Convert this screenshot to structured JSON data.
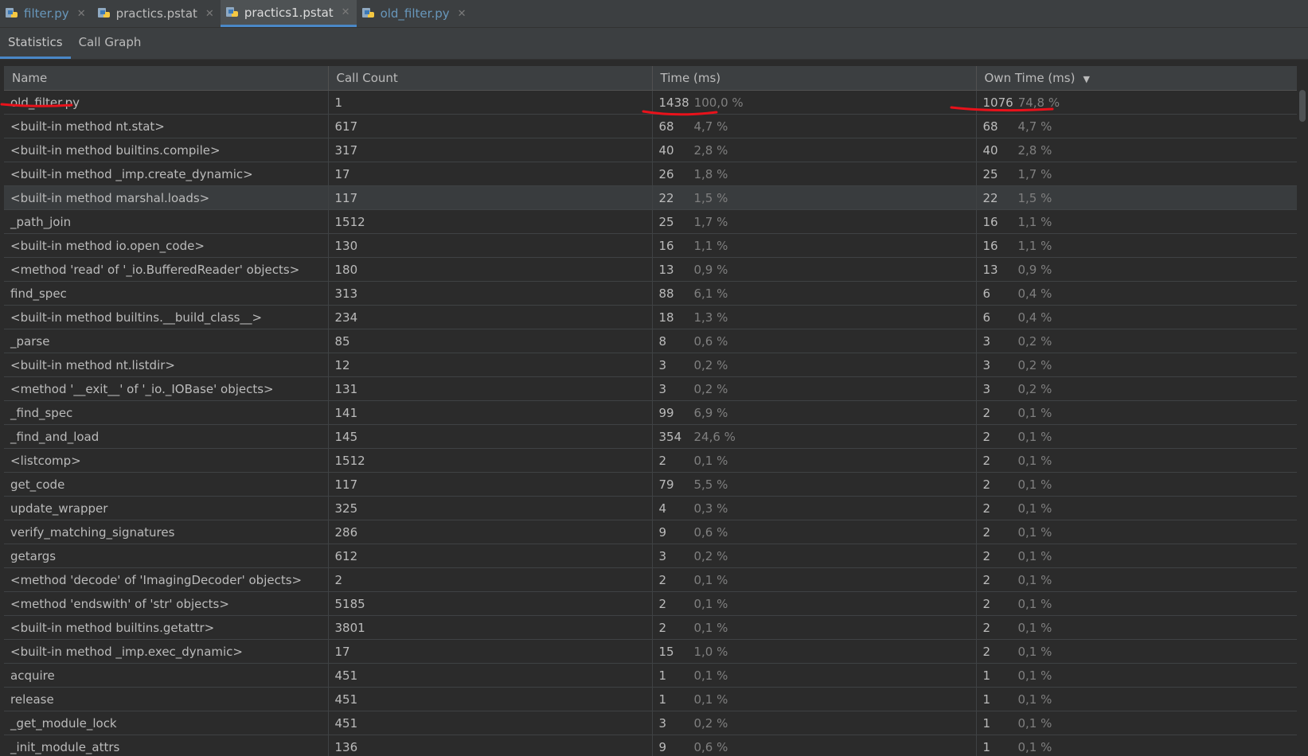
{
  "tabs": [
    {
      "label": "filter.py",
      "style": "blue"
    },
    {
      "label": "practics.pstat",
      "style": "plain"
    },
    {
      "label": "practics1.pstat",
      "style": "active"
    },
    {
      "label": "old_filter.py",
      "style": "blue"
    }
  ],
  "view_tabs": [
    {
      "label": "Statistics",
      "active": true
    },
    {
      "label": "Call Graph",
      "active": false
    }
  ],
  "columns": [
    "Name",
    "Call Count",
    "Time (ms)",
    "Own Time (ms)"
  ],
  "sort_column": "Own Time (ms)",
  "sort_direction": "descending",
  "rows": [
    {
      "name": "old_filter.py",
      "calls": "1",
      "time": "1438",
      "time_pct": "100,0 %",
      "own": "1076",
      "own_pct": "74,8 %"
    },
    {
      "name": "<built-in method nt.stat>",
      "calls": "617",
      "time": "68",
      "time_pct": "4,7 %",
      "own": "68",
      "own_pct": "4,7 %"
    },
    {
      "name": "<built-in method builtins.compile>",
      "calls": "317",
      "time": "40",
      "time_pct": "2,8 %",
      "own": "40",
      "own_pct": "2,8 %"
    },
    {
      "name": "<built-in method _imp.create_dynamic>",
      "calls": "17",
      "time": "26",
      "time_pct": "1,8 %",
      "own": "25",
      "own_pct": "1,7 %"
    },
    {
      "name": "<built-in method marshal.loads>",
      "calls": "117",
      "time": "22",
      "time_pct": "1,5 %",
      "own": "22",
      "own_pct": "1,5 %"
    },
    {
      "name": "_path_join",
      "calls": "1512",
      "time": "25",
      "time_pct": "1,7 %",
      "own": "16",
      "own_pct": "1,1 %"
    },
    {
      "name": "<built-in method io.open_code>",
      "calls": "130",
      "time": "16",
      "time_pct": "1,1 %",
      "own": "16",
      "own_pct": "1,1 %"
    },
    {
      "name": "<method 'read' of '_io.BufferedReader' objects>",
      "calls": "180",
      "time": "13",
      "time_pct": "0,9 %",
      "own": "13",
      "own_pct": "0,9 %"
    },
    {
      "name": "find_spec",
      "calls": "313",
      "time": "88",
      "time_pct": "6,1 %",
      "own": "6",
      "own_pct": "0,4 %"
    },
    {
      "name": "<built-in method builtins.__build_class__>",
      "calls": "234",
      "time": "18",
      "time_pct": "1,3 %",
      "own": "6",
      "own_pct": "0,4 %"
    },
    {
      "name": "_parse",
      "calls": "85",
      "time": "8",
      "time_pct": "0,6 %",
      "own": "3",
      "own_pct": "0,2 %"
    },
    {
      "name": "<built-in method nt.listdir>",
      "calls": "12",
      "time": "3",
      "time_pct": "0,2 %",
      "own": "3",
      "own_pct": "0,2 %"
    },
    {
      "name": "<method '__exit__' of '_io._IOBase' objects>",
      "calls": "131",
      "time": "3",
      "time_pct": "0,2 %",
      "own": "3",
      "own_pct": "0,2 %"
    },
    {
      "name": "_find_spec",
      "calls": "141",
      "time": "99",
      "time_pct": "6,9 %",
      "own": "2",
      "own_pct": "0,1 %"
    },
    {
      "name": "_find_and_load",
      "calls": "145",
      "time": "354",
      "time_pct": "24,6 %",
      "own": "2",
      "own_pct": "0,1 %"
    },
    {
      "name": "<listcomp>",
      "calls": "1512",
      "time": "2",
      "time_pct": "0,1 %",
      "own": "2",
      "own_pct": "0,1 %"
    },
    {
      "name": "get_code",
      "calls": "117",
      "time": "79",
      "time_pct": "5,5 %",
      "own": "2",
      "own_pct": "0,1 %"
    },
    {
      "name": "update_wrapper",
      "calls": "325",
      "time": "4",
      "time_pct": "0,3 %",
      "own": "2",
      "own_pct": "0,1 %"
    },
    {
      "name": "verify_matching_signatures",
      "calls": "286",
      "time": "9",
      "time_pct": "0,6 %",
      "own": "2",
      "own_pct": "0,1 %"
    },
    {
      "name": "getargs",
      "calls": "612",
      "time": "3",
      "time_pct": "0,2 %",
      "own": "2",
      "own_pct": "0,1 %"
    },
    {
      "name": "<method 'decode' of 'ImagingDecoder' objects>",
      "calls": "2",
      "time": "2",
      "time_pct": "0,1 %",
      "own": "2",
      "own_pct": "0,1 %"
    },
    {
      "name": "<method 'endswith' of 'str' objects>",
      "calls": "5185",
      "time": "2",
      "time_pct": "0,1 %",
      "own": "2",
      "own_pct": "0,1 %"
    },
    {
      "name": "<built-in method builtins.getattr>",
      "calls": "3801",
      "time": "2",
      "time_pct": "0,1 %",
      "own": "2",
      "own_pct": "0,1 %"
    },
    {
      "name": "<built-in method _imp.exec_dynamic>",
      "calls": "17",
      "time": "15",
      "time_pct": "1,0 %",
      "own": "2",
      "own_pct": "0,1 %"
    },
    {
      "name": "acquire",
      "calls": "451",
      "time": "1",
      "time_pct": "0,1 %",
      "own": "1",
      "own_pct": "0,1 %"
    },
    {
      "name": "release",
      "calls": "451",
      "time": "1",
      "time_pct": "0,1 %",
      "own": "1",
      "own_pct": "0,1 %"
    },
    {
      "name": "_get_module_lock",
      "calls": "451",
      "time": "3",
      "time_pct": "0,2 %",
      "own": "1",
      "own_pct": "0,1 %"
    },
    {
      "name": "_init_module_attrs",
      "calls": "136",
      "time": "9",
      "time_pct": "0,6 %",
      "own": "1",
      "own_pct": "0,1 %"
    }
  ],
  "selected_row": 4,
  "colors": {
    "accent": "#4a88c7",
    "annotation": "#e8121b",
    "background": "#2b2b2b",
    "header": "#3c3f41"
  }
}
